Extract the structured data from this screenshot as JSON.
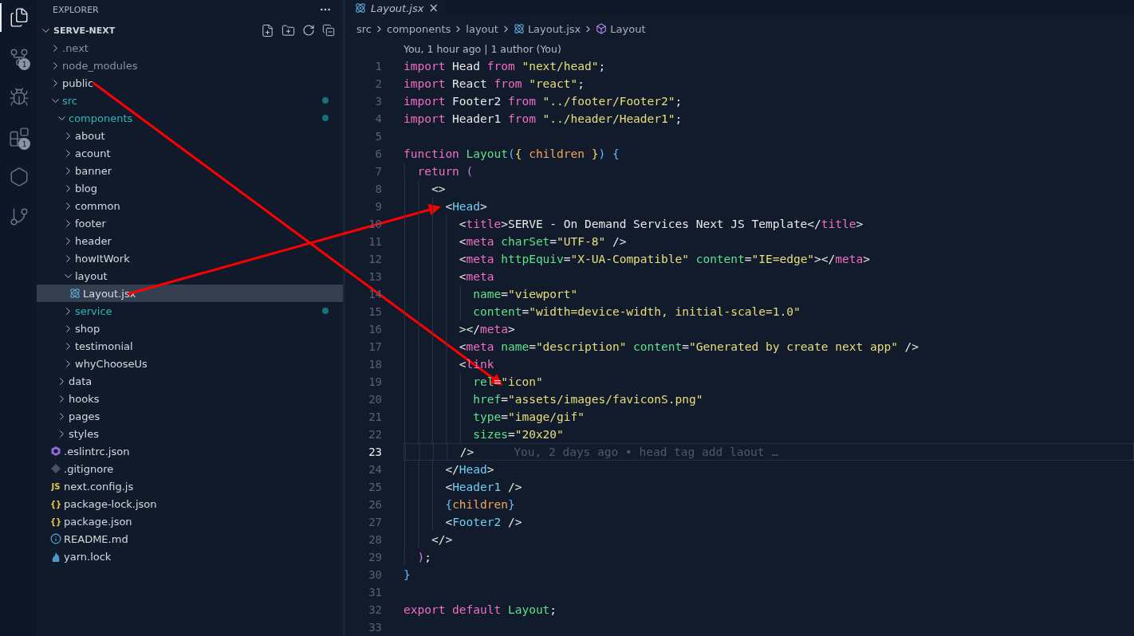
{
  "activity_bar": [
    {
      "kind": "explorer",
      "selected": true
    },
    {
      "kind": "source-control",
      "selected": false,
      "badge": "1"
    },
    {
      "kind": "run-debug",
      "selected": false
    },
    {
      "kind": "extensions",
      "selected": false,
      "badge": "1"
    },
    {
      "kind": "hexagon",
      "selected": false
    },
    {
      "kind": "git-graph",
      "selected": false
    }
  ],
  "sidebar": {
    "title": "EXPLORER",
    "folder": {
      "name": "SERVE-NEXT",
      "expanded": true
    },
    "items": [
      {
        "name": ".next",
        "kind": "folder",
        "expanded": false,
        "ignored": true,
        "modified": false,
        "selected": false
      },
      {
        "name": "node_modules",
        "kind": "folder",
        "expanded": false,
        "ignored": true,
        "modified": false,
        "selected": false
      },
      {
        "name": "public",
        "kind": "folder",
        "expanded": false,
        "ignored": false,
        "modified": false,
        "selected": false
      },
      {
        "name": "src",
        "kind": "folder",
        "expanded": true,
        "ignored": false,
        "modified": true,
        "selected": false,
        "children": [
          {
            "name": "components",
            "kind": "folder",
            "expanded": true,
            "ignored": false,
            "modified": true,
            "selected": false,
            "children": [
              {
                "name": "about",
                "kind": "folder",
                "expanded": false,
                "ignored": false,
                "modified": false,
                "selected": false
              },
              {
                "name": "acount",
                "kind": "folder",
                "expanded": false,
                "ignored": false,
                "modified": false,
                "selected": false
              },
              {
                "name": "banner",
                "kind": "folder",
                "expanded": false,
                "ignored": false,
                "modified": false,
                "selected": false
              },
              {
                "name": "blog",
                "kind": "folder",
                "expanded": false,
                "ignored": false,
                "modified": false,
                "selected": false
              },
              {
                "name": "common",
                "kind": "folder",
                "expanded": false,
                "ignored": false,
                "modified": false,
                "selected": false
              },
              {
                "name": "footer",
                "kind": "folder",
                "expanded": false,
                "ignored": false,
                "modified": false,
                "selected": false
              },
              {
                "name": "header",
                "kind": "folder",
                "expanded": false,
                "ignored": false,
                "modified": false,
                "selected": false
              },
              {
                "name": "howItWork",
                "kind": "folder",
                "expanded": false,
                "ignored": false,
                "modified": false,
                "selected": false
              },
              {
                "name": "layout",
                "kind": "folder",
                "expanded": true,
                "ignored": false,
                "modified": false,
                "selected": false,
                "children": [
                  {
                    "name": "Layout.jsx",
                    "kind": "react",
                    "ignored": false,
                    "modified": false,
                    "selected": true
                  }
                ]
              },
              {
                "name": "service",
                "kind": "folder",
                "expanded": false,
                "ignored": false,
                "modified": true,
                "selected": false
              },
              {
                "name": "shop",
                "kind": "folder",
                "expanded": false,
                "ignored": false,
                "modified": false,
                "selected": false
              },
              {
                "name": "testimonial",
                "kind": "folder",
                "expanded": false,
                "ignored": false,
                "modified": false,
                "selected": false
              },
              {
                "name": "whyChooseUs",
                "kind": "folder",
                "expanded": false,
                "ignored": false,
                "modified": false,
                "selected": false
              }
            ]
          },
          {
            "name": "data",
            "kind": "folder",
            "expanded": false,
            "ignored": false,
            "modified": false,
            "selected": false
          },
          {
            "name": "hooks",
            "kind": "folder",
            "expanded": false,
            "ignored": false,
            "modified": false,
            "selected": false
          },
          {
            "name": "pages",
            "kind": "folder",
            "expanded": false,
            "ignored": false,
            "modified": false,
            "selected": false
          },
          {
            "name": "styles",
            "kind": "folder",
            "expanded": false,
            "ignored": false,
            "modified": false,
            "selected": false
          }
        ]
      },
      {
        "name": ".eslintrc.json",
        "kind": "eslint",
        "ignored": false,
        "modified": false,
        "selected": false
      },
      {
        "name": ".gitignore",
        "kind": "git",
        "ignored": false,
        "modified": false,
        "selected": false
      },
      {
        "name": "next.config.js",
        "kind": "js",
        "icon_text": "JS",
        "ignored": false,
        "modified": false,
        "selected": false
      },
      {
        "name": "package-lock.json",
        "kind": "json",
        "icon_text": "{}",
        "ignored": false,
        "modified": false,
        "selected": false
      },
      {
        "name": "package.json",
        "kind": "json",
        "icon_text": "{}",
        "ignored": false,
        "modified": false,
        "selected": false
      },
      {
        "name": "README.md",
        "kind": "info",
        "ignored": false,
        "modified": false,
        "selected": false
      },
      {
        "name": "yarn.lock",
        "kind": "yarn",
        "ignored": false,
        "modified": false,
        "selected": false
      }
    ]
  },
  "editor": {
    "tab": {
      "label": "Layout.jsx",
      "close": "×",
      "selected": true
    },
    "breadcrumbs": [
      {
        "text": "src",
        "kind": "folder"
      },
      {
        "text": "components",
        "kind": "folder"
      },
      {
        "text": "layout",
        "kind": "folder"
      },
      {
        "text": "Layout.jsx",
        "kind": "react"
      },
      {
        "text": "Layout",
        "kind": "symbol"
      }
    ],
    "blame_header": "You, 1 hour ago | 1 author (You)",
    "lines": [
      {
        "num": "1",
        "current": false,
        "tokens": [
          {
            "kind": "kw",
            "text": "import"
          },
          {
            "kind": "id",
            "text": " Head "
          },
          {
            "kind": "kw",
            "text": "from"
          },
          {
            "kind": "str",
            "text": " \"next/head\""
          },
          {
            "kind": "id",
            "text": ";"
          }
        ]
      },
      {
        "num": "2",
        "current": false,
        "tokens": [
          {
            "kind": "kw",
            "text": "import"
          },
          {
            "kind": "id",
            "text": " React "
          },
          {
            "kind": "kw",
            "text": "from"
          },
          {
            "kind": "str",
            "text": " \"react\""
          },
          {
            "kind": "id",
            "text": ";"
          }
        ]
      },
      {
        "num": "3",
        "current": false,
        "tokens": [
          {
            "kind": "kw",
            "text": "import"
          },
          {
            "kind": "id",
            "text": " Footer2 "
          },
          {
            "kind": "kw",
            "text": "from"
          },
          {
            "kind": "str",
            "text": " \"../footer/Footer2\""
          },
          {
            "kind": "id",
            "text": ";"
          }
        ]
      },
      {
        "num": "4",
        "current": false,
        "tokens": [
          {
            "kind": "kw",
            "text": "import"
          },
          {
            "kind": "id",
            "text": " Header1 "
          },
          {
            "kind": "kw",
            "text": "from"
          },
          {
            "kind": "str",
            "text": " \"../header/Header1\""
          },
          {
            "kind": "id",
            "text": ";"
          }
        ]
      },
      {
        "num": "5",
        "current": false
      },
      {
        "num": "6",
        "current": false,
        "tokens": [
          {
            "kind": "kw",
            "text": "function"
          },
          {
            "kind": "fn",
            "text": " Layout"
          },
          {
            "kind": "blue",
            "text": "("
          },
          {
            "kind": "yellow",
            "text": "{"
          },
          {
            "kind": "param",
            "text": " children "
          },
          {
            "kind": "yellow",
            "text": "}"
          },
          {
            "kind": "blue",
            "text": ")"
          },
          {
            "kind": "blue",
            "text": " {"
          }
        ]
      },
      {
        "num": "7",
        "current": false,
        "tokens": [
          {
            "kind": "kw",
            "text": "  return"
          },
          {
            "kind": "purple",
            "text": " ("
          }
        ]
      },
      {
        "num": "8",
        "current": false,
        "tokens": [
          {
            "kind": "id",
            "text": "    <>"
          }
        ]
      },
      {
        "num": "9",
        "current": false,
        "tokens": [
          {
            "kind": "id",
            "text": "      <"
          },
          {
            "kind": "comp",
            "text": "Head"
          },
          {
            "kind": "id",
            "text": ">"
          }
        ]
      },
      {
        "num": "10",
        "current": false,
        "tokens": [
          {
            "kind": "id",
            "text": "        <"
          },
          {
            "kind": "kw",
            "text": "title"
          },
          {
            "kind": "id",
            "text": ">SERVE - On Demand Services Next JS Template</"
          },
          {
            "kind": "kw",
            "text": "title"
          },
          {
            "kind": "id",
            "text": ">"
          }
        ]
      },
      {
        "num": "11",
        "current": false,
        "tokens": [
          {
            "kind": "id",
            "text": "        <"
          },
          {
            "kind": "kw",
            "text": "meta"
          },
          {
            "kind": "fn",
            "text": " charSet"
          },
          {
            "kind": "id",
            "text": "="
          },
          {
            "kind": "str",
            "text": "\"UTF-8\""
          },
          {
            "kind": "id",
            "text": " />"
          }
        ]
      },
      {
        "num": "12",
        "current": false,
        "tokens": [
          {
            "kind": "id",
            "text": "        <"
          },
          {
            "kind": "kw",
            "text": "meta"
          },
          {
            "kind": "fn",
            "text": " httpEquiv"
          },
          {
            "kind": "id",
            "text": "="
          },
          {
            "kind": "str",
            "text": "\"X-UA-Compatible\""
          },
          {
            "kind": "fn",
            "text": " content"
          },
          {
            "kind": "id",
            "text": "="
          },
          {
            "kind": "str",
            "text": "\"IE=edge\""
          },
          {
            "kind": "id",
            "text": "></"
          },
          {
            "kind": "kw",
            "text": "meta"
          },
          {
            "kind": "id",
            "text": ">"
          }
        ]
      },
      {
        "num": "13",
        "current": false,
        "tokens": [
          {
            "kind": "id",
            "text": "        <"
          },
          {
            "kind": "kw",
            "text": "meta"
          }
        ]
      },
      {
        "num": "14",
        "current": false,
        "tokens": [
          {
            "kind": "fn",
            "text": "          name"
          },
          {
            "kind": "id",
            "text": "="
          },
          {
            "kind": "str",
            "text": "\"viewport\""
          }
        ]
      },
      {
        "num": "15",
        "current": false,
        "tokens": [
          {
            "kind": "fn",
            "text": "          content"
          },
          {
            "kind": "id",
            "text": "="
          },
          {
            "kind": "str",
            "text": "\"width=device-width, initial-scale=1.0\""
          }
        ]
      },
      {
        "num": "16",
        "current": false,
        "tokens": [
          {
            "kind": "id",
            "text": "        ></"
          },
          {
            "kind": "kw",
            "text": "meta"
          },
          {
            "kind": "id",
            "text": ">"
          }
        ]
      },
      {
        "num": "17",
        "current": false,
        "tokens": [
          {
            "kind": "id",
            "text": "        <"
          },
          {
            "kind": "kw",
            "text": "meta"
          },
          {
            "kind": "fn",
            "text": " name"
          },
          {
            "kind": "id",
            "text": "="
          },
          {
            "kind": "str",
            "text": "\"description\""
          },
          {
            "kind": "fn",
            "text": " content"
          },
          {
            "kind": "id",
            "text": "="
          },
          {
            "kind": "str",
            "text": "\"Generated by create next app\""
          },
          {
            "kind": "id",
            "text": " />"
          }
        ]
      },
      {
        "num": "18",
        "current": false,
        "tokens": [
          {
            "kind": "id",
            "text": "        <"
          },
          {
            "kind": "kw",
            "text": "link"
          }
        ]
      },
      {
        "num": "19",
        "current": false,
        "tokens": [
          {
            "kind": "fn",
            "text": "          rel"
          },
          {
            "kind": "id",
            "text": "="
          },
          {
            "kind": "str",
            "text": "\"icon\""
          }
        ]
      },
      {
        "num": "20",
        "current": false,
        "tokens": [
          {
            "kind": "fn",
            "text": "          href"
          },
          {
            "kind": "id",
            "text": "="
          },
          {
            "kind": "str",
            "text": "\"assets/images/faviconS.png\""
          }
        ]
      },
      {
        "num": "21",
        "current": false,
        "tokens": [
          {
            "kind": "fn",
            "text": "          type"
          },
          {
            "kind": "id",
            "text": "="
          },
          {
            "kind": "str",
            "text": "\"image/gif\""
          }
        ]
      },
      {
        "num": "22",
        "current": false,
        "tokens": [
          {
            "kind": "fn",
            "text": "          sizes"
          },
          {
            "kind": "id",
            "text": "="
          },
          {
            "kind": "str",
            "text": "\"20x20\""
          }
        ]
      },
      {
        "num": "23",
        "current": true,
        "blame": "You, 2 days ago • head tag add laout …",
        "tokens": [
          {
            "kind": "id",
            "text": "        />"
          }
        ]
      },
      {
        "num": "24",
        "current": false,
        "tokens": [
          {
            "kind": "id",
            "text": "      </"
          },
          {
            "kind": "comp",
            "text": "Head"
          },
          {
            "kind": "id",
            "text": ">"
          }
        ]
      },
      {
        "num": "25",
        "current": false,
        "tokens": [
          {
            "kind": "id",
            "text": "      <"
          },
          {
            "kind": "comp",
            "text": "Header1"
          },
          {
            "kind": "id",
            "text": " />"
          }
        ]
      },
      {
        "num": "26",
        "current": false,
        "tokens": [
          {
            "kind": "blue",
            "text": "      {"
          },
          {
            "kind": "param",
            "text": "children"
          },
          {
            "kind": "blue",
            "text": "}"
          }
        ]
      },
      {
        "num": "27",
        "current": false,
        "tokens": [
          {
            "kind": "id",
            "text": "      <"
          },
          {
            "kind": "comp",
            "text": "Footer2"
          },
          {
            "kind": "id",
            "text": " />"
          }
        ]
      },
      {
        "num": "28",
        "current": false,
        "tokens": [
          {
            "kind": "id",
            "text": "    </>"
          }
        ]
      },
      {
        "num": "29",
        "current": false,
        "tokens": [
          {
            "kind": "purple",
            "text": "  )"
          },
          {
            "kind": "id",
            "text": ";"
          }
        ]
      },
      {
        "num": "30",
        "current": false,
        "tokens": [
          {
            "kind": "blue",
            "text": "}"
          }
        ]
      },
      {
        "num": "31",
        "current": false
      },
      {
        "num": "32",
        "current": false,
        "tokens": [
          {
            "kind": "kw",
            "text": "export"
          },
          {
            "kind": "kw",
            "text": " default"
          },
          {
            "kind": "fn",
            "text": " Layout"
          },
          {
            "kind": "id",
            "text": ";"
          }
        ]
      },
      {
        "num": "33",
        "current": false
      }
    ]
  }
}
